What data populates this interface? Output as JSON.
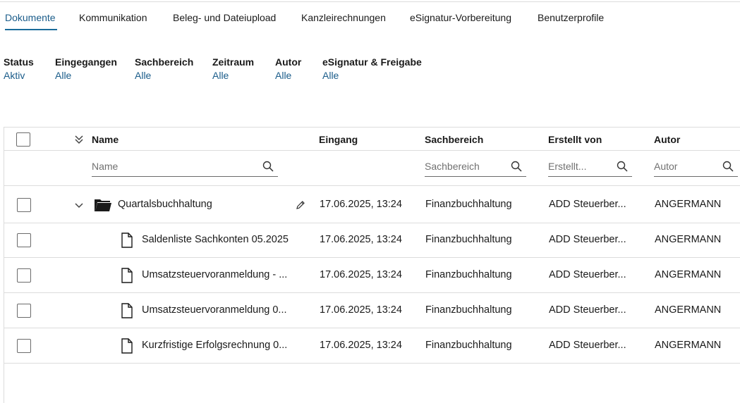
{
  "tabs": [
    {
      "label": "Dokumente",
      "active": true
    },
    {
      "label": "Kommunikation",
      "active": false
    },
    {
      "label": "Beleg- und Dateiupload",
      "active": false
    },
    {
      "label": "Kanzleirechnungen",
      "active": false
    },
    {
      "label": "eSignatur-Vorbereitung",
      "active": false
    },
    {
      "label": "Benutzerprofile",
      "active": false
    }
  ],
  "filters": [
    {
      "label": "Status",
      "value": "Aktiv"
    },
    {
      "label": "Eingegangen",
      "value": "Alle"
    },
    {
      "label": "Sachbereich",
      "value": "Alle"
    },
    {
      "label": "Zeitraum",
      "value": "Alle"
    },
    {
      "label": "Autor",
      "value": "Alle"
    },
    {
      "label": "eSignatur & Freigabe",
      "value": "Alle"
    }
  ],
  "table": {
    "columns": {
      "name": "Name",
      "eingang": "Eingang",
      "sachbereich": "Sachbereich",
      "erstellt_von": "Erstellt von",
      "autor": "Autor"
    },
    "search_placeholders": {
      "name": "Name",
      "sachbereich": "Sachbereich",
      "erstellt_von": "Erstellt...",
      "autor": "Autor"
    },
    "rows": [
      {
        "type": "folder",
        "name": "Quartalsbuchhaltung",
        "eingang": "17.06.2025, 13:24",
        "sachbereich": "Finanzbuchhaltung",
        "erstellt_von": "ADD Steuerber...",
        "autor": "ANGERMANN"
      },
      {
        "type": "file",
        "name": "Saldenliste Sachkonten 05.2025",
        "eingang": "17.06.2025, 13:24",
        "sachbereich": "Finanzbuchhaltung",
        "erstellt_von": "ADD Steuerber...",
        "autor": "ANGERMANN"
      },
      {
        "type": "file",
        "name": "Umsatzsteuervoranmeldung - ...",
        "eingang": "17.06.2025, 13:24",
        "sachbereich": "Finanzbuchhaltung",
        "erstellt_von": "ADD Steuerber...",
        "autor": "ANGERMANN"
      },
      {
        "type": "file",
        "name": "Umsatzsteuervoranmeldung 0...",
        "eingang": "17.06.2025, 13:24",
        "sachbereich": "Finanzbuchhaltung",
        "erstellt_von": "ADD Steuerber...",
        "autor": "ANGERMANN"
      },
      {
        "type": "file",
        "name": "Kurzfristige Erfolgsrechnung 0...",
        "eingang": "17.06.2025, 13:24",
        "sachbereich": "Finanzbuchhaltung",
        "erstellt_von": "ADD Steuerber...",
        "autor": "ANGERMANN"
      }
    ]
  },
  "icons": {
    "collapse_all": "chevrons-down-icon",
    "search": "search-icon",
    "folder": "folder-icon",
    "file": "document-icon",
    "edit": "pencil-icon",
    "expand": "chevron-down-icon"
  },
  "colors": {
    "accent": "#1a5c8a",
    "border": "#dcdcdc",
    "text": "#1a1a1a"
  }
}
